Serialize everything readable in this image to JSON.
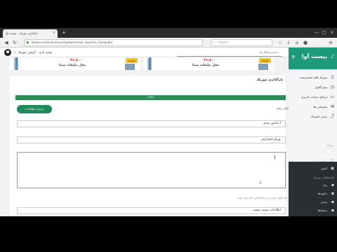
{
  "browser": {
    "tab_title": "بارگذاری موزیک - بیست آوا",
    "url": "ibsava.com/user/music/upload-music.aspx?id=1&mpublic",
    "search_placeholder": "Search",
    "new_tab": "+",
    "tab_close": "×",
    "window_controls": [
      "—",
      "□",
      "×"
    ]
  },
  "topbar": {
    "user_name": "وحید یاری - گرفتن موزیک",
    "search_placeholder": "جستجو آهنگ ها..."
  },
  "banners": [
    {
      "price": "۳۶,۸۰۰",
      "slogan": "محل تبلیغات شما",
      "tag": "تبلیغات"
    },
    {
      "price": "۳۶,۸۰۰",
      "slogan": "محل تبلیغات شما",
      "tag": "تبلیغات"
    }
  ],
  "form": {
    "title": "بارگذاری موزیک",
    "progress_percent": 100,
    "progress_label": "100%",
    "send_button": "ارسال اطلاعات",
    "welcome": "بارگذاری با موفقیت به پایان رسید",
    "song_name_label": "عنوان اثر",
    "song_name_value": "آ عاشق شدم",
    "artist_label": "خالق اثر",
    "artist_value": "بهرام فتح‌پارهی",
    "description_label": "توضیحات اضافه",
    "help_line1": "نویسنده اثر",
    "help_line2": "حداکثر متن توضیح / درست که طول فرم کم از 8 کاراکتر باشد وارد کنید",
    "footer_field": "اطلاعات بیشتر نیست"
  },
  "sidebar": {
    "brand": "بیست آوا",
    "top_items": [
      {
        "label": "موزیک های منتشرشده",
        "icon": "music-note-icon"
      },
      {
        "label": "پیش‌گالوی",
        "icon": "history-icon"
      },
      {
        "label": "ارتقای حساب کاربری",
        "icon": "upgrade-icon"
      },
      {
        "label": "پشتیبانی ها",
        "icon": "support-icon"
      },
      {
        "label": "پخش اشتراک",
        "icon": "share-icon"
      }
    ],
    "bottom_section_title": "پروفایل",
    "bottom_items": [
      {
        "label": "موزیک",
        "icon": "music-icon"
      },
      {
        "label": "پیش‌گالوی",
        "icon": "gallery-icon"
      },
      {
        "label": "آلبوم",
        "icon": "album-icon"
      }
    ],
    "bottom_section2_title": "آمار فعالیت موزیک",
    "bottom_items2": [
      {
        "label": "رای",
        "icon": "vote-icon"
      },
      {
        "label": "دانلودها",
        "icon": "download-icon"
      },
      {
        "label": "پخش",
        "icon": "play-icon"
      },
      {
        "label": "تماشاها",
        "icon": "eye-icon"
      },
      {
        "label": "لایک",
        "icon": "like-icon"
      }
    ]
  }
}
